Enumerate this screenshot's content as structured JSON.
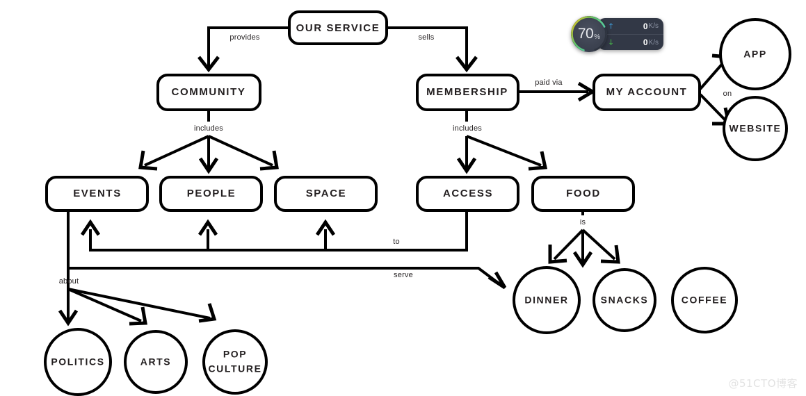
{
  "diagram": {
    "type": "node-link-flowchart",
    "background_color": "#ffffff",
    "stroke_color": "#000000",
    "text_color": "#231f20",
    "nodes": {
      "our_service": "OUR SERVICE",
      "community": "COMMUNITY",
      "membership": "MEMBERSHIP",
      "my_account": "MY ACCOUNT",
      "app": "APP",
      "website": "WEBSITE",
      "events": "EVENTS",
      "people": "PEOPLE",
      "space": "SPACE",
      "access": "ACCESS",
      "food": "FOOD",
      "politics": "POLITICS",
      "arts": "ARTS",
      "pop_culture_line1": "POP",
      "pop_culture_line2": "CULTURE",
      "dinner": "DINNER",
      "snacks": "SNACKS",
      "coffee": "COFFEE"
    },
    "edge_labels": {
      "provides": "provides",
      "sells": "sells",
      "paid_via": "paid via",
      "on": "on",
      "includes_left": "includes",
      "includes_right": "includes",
      "to": "to",
      "serve": "serve",
      "about": "about",
      "is": "is"
    }
  },
  "widget": {
    "name": "network-speed-monitor",
    "gauge_percent_value": "70",
    "gauge_percent_unit": "%",
    "gauge_fill_ratio": 0.7,
    "gauge_colors": {
      "start": "#f0c419",
      "mid": "#5ec46a",
      "end": "#4fd1c5",
      "track": "#2e3440"
    },
    "panel_bg": "#323846",
    "upload": {
      "arrow": "↑",
      "value": "0",
      "unit": "K/s",
      "color": "#3f9ad6"
    },
    "download": {
      "arrow": "↓",
      "value": "0",
      "unit": "K/s",
      "color": "#49b84a"
    }
  },
  "watermark": {
    "text": "@51CTO博客"
  }
}
